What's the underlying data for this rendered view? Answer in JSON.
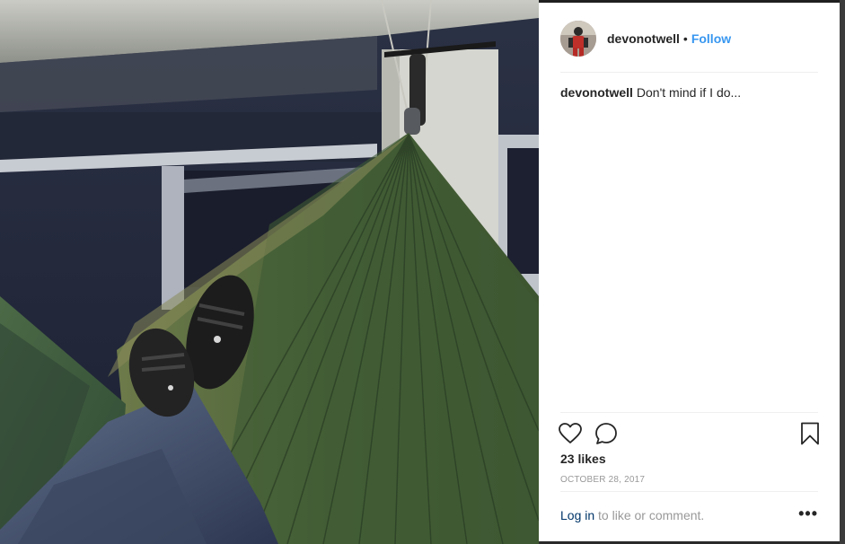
{
  "post": {
    "username": "devonotwell",
    "separator": "•",
    "follow_label": "Follow",
    "caption_user": "devonotwell",
    "caption_text": "Don't mind if I do...",
    "likes_text": "23 likes",
    "date_text": "OCTOBER 28, 2017",
    "login_label": "Log in",
    "comment_prompt": "to like or comment.",
    "more_label": "•••"
  },
  "icons": {
    "like": "heart-icon",
    "comment": "comment-icon",
    "save": "bookmark-icon",
    "more": "more-options-icon"
  },
  "colors": {
    "follow": "#3897f0",
    "text": "#262626",
    "muted": "#999999",
    "login_link": "#003569",
    "hammock_green": "#4f6b3c"
  }
}
